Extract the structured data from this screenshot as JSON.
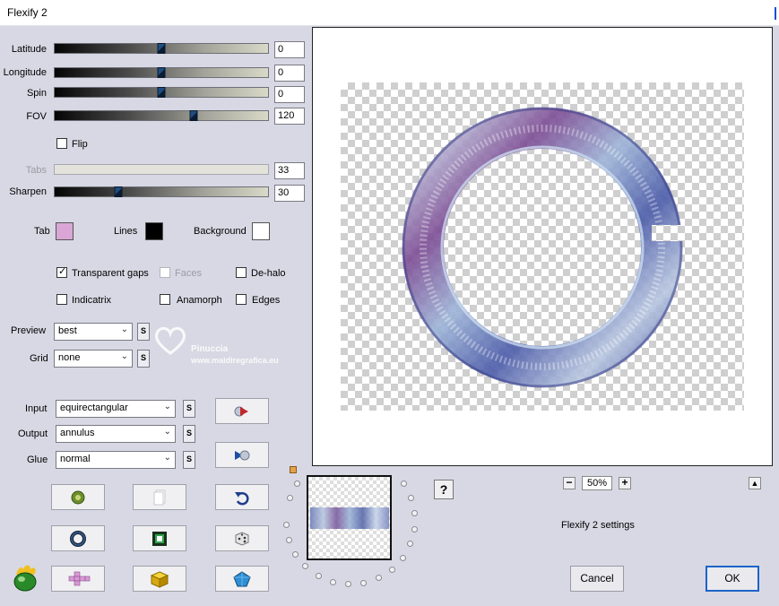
{
  "window": {
    "title": "Flexify 2"
  },
  "sliders": [
    {
      "label": "Latitude",
      "value": "0",
      "level": 0.5,
      "enabled": true
    },
    {
      "label": "Longitude",
      "value": "0",
      "level": 0.5,
      "enabled": true
    },
    {
      "label": "Spin",
      "value": "0",
      "level": 0.5,
      "enabled": true
    },
    {
      "label": "FOV",
      "value": "120",
      "level": 0.65,
      "enabled": true
    },
    {
      "label": "Tabs",
      "value": "33",
      "level": null,
      "enabled": false
    },
    {
      "label": "Sharpen",
      "value": "30",
      "level": 0.3,
      "enabled": true
    }
  ],
  "flip": {
    "label": "Flip",
    "checked": false
  },
  "colors": {
    "tab": {
      "label": "Tab",
      "hex": "#d9a6d6"
    },
    "lines": {
      "label": "Lines",
      "hex": "#000000"
    },
    "background": {
      "label": "Background",
      "hex": "#ffffff"
    }
  },
  "options": {
    "transparent_gaps": {
      "label": "Transparent gaps",
      "checked": true
    },
    "faces": {
      "label": "Faces",
      "checked": false,
      "enabled": false
    },
    "de_halo": {
      "label": "De-halo",
      "checked": false
    },
    "indicatrix": {
      "label": "Indicatrix",
      "checked": false
    },
    "anamorph": {
      "label": "Anamorph",
      "checked": false
    },
    "edges": {
      "label": "Edges",
      "checked": false
    }
  },
  "selects": {
    "preview": {
      "label": "Preview",
      "value": "best",
      "s": "S"
    },
    "grid": {
      "label": "Grid",
      "value": "none",
      "s": "S"
    },
    "input": {
      "label": "Input",
      "value": "equirectangular",
      "s": "S"
    },
    "output": {
      "label": "Output",
      "value": "annulus",
      "s": "S"
    },
    "glue": {
      "label": "Glue",
      "value": "normal",
      "s": "S"
    }
  },
  "watermark": {
    "line1": "Pinuccia",
    "line2": "www.maidiregrafica.eu"
  },
  "zoom": {
    "value": "50%",
    "minus": "−",
    "plus": "+"
  },
  "help": "?",
  "settings_text": "Flexify 2 settings",
  "scroll_up": "▲",
  "buttons": {
    "cancel": "Cancel",
    "ok": "OK"
  },
  "palette": {
    "accent": "#1c64c8",
    "ring_blue": "#4a5aa8",
    "ring_purple": "#7c4c94",
    "ring_pale": "#cfe0ee"
  }
}
